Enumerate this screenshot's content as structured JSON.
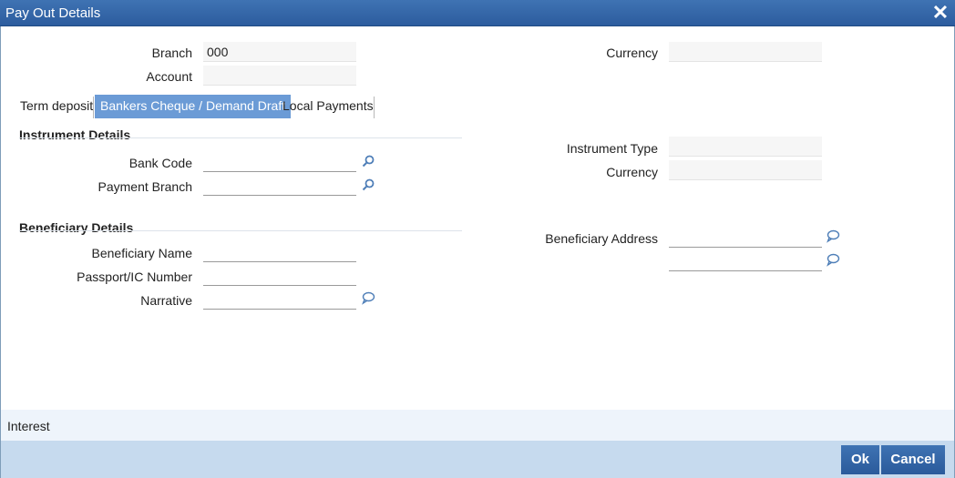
{
  "window": {
    "title": "Pay Out Details",
    "close_glyph": "✕"
  },
  "header": {
    "branch_label": "Branch",
    "branch_value": "000",
    "account_label": "Account",
    "account_value": "",
    "currency_label": "Currency",
    "currency_value": ""
  },
  "tabs": [
    {
      "label": "Term deposit",
      "active": false
    },
    {
      "label": "Bankers Cheque / Demand Draft",
      "active": true
    },
    {
      "label": "Local Payments",
      "active": false
    }
  ],
  "instrument": {
    "section_title": "Instrument Details",
    "bank_code_label": "Bank Code",
    "bank_code_value": "",
    "payment_branch_label": "Payment Branch",
    "payment_branch_value": "",
    "instrument_type_label": "Instrument Type",
    "instrument_type_value": "",
    "currency_label": "Currency",
    "currency_value": ""
  },
  "beneficiary": {
    "section_title": "Beneficiary Details",
    "name_label": "Beneficiary Name",
    "name_value": "",
    "passport_label": "Passport/IC Number",
    "passport_value": "",
    "narrative_label": "Narrative",
    "narrative_value": "",
    "address_label": "Beneficiary Address",
    "address_line1": "",
    "address_line2": ""
  },
  "footer": {
    "interest_label": "Interest",
    "ok_label": "Ok",
    "cancel_label": "Cancel"
  },
  "colors": {
    "title_bar": "#2c5c9e",
    "active_tab": "#6b9bd6",
    "footer_bar": "#c6daee",
    "button": "#2a5a9b"
  },
  "icons": {
    "lookup": "search-icon",
    "text_edit": "speech-bubble-icon",
    "close": "close-icon"
  }
}
